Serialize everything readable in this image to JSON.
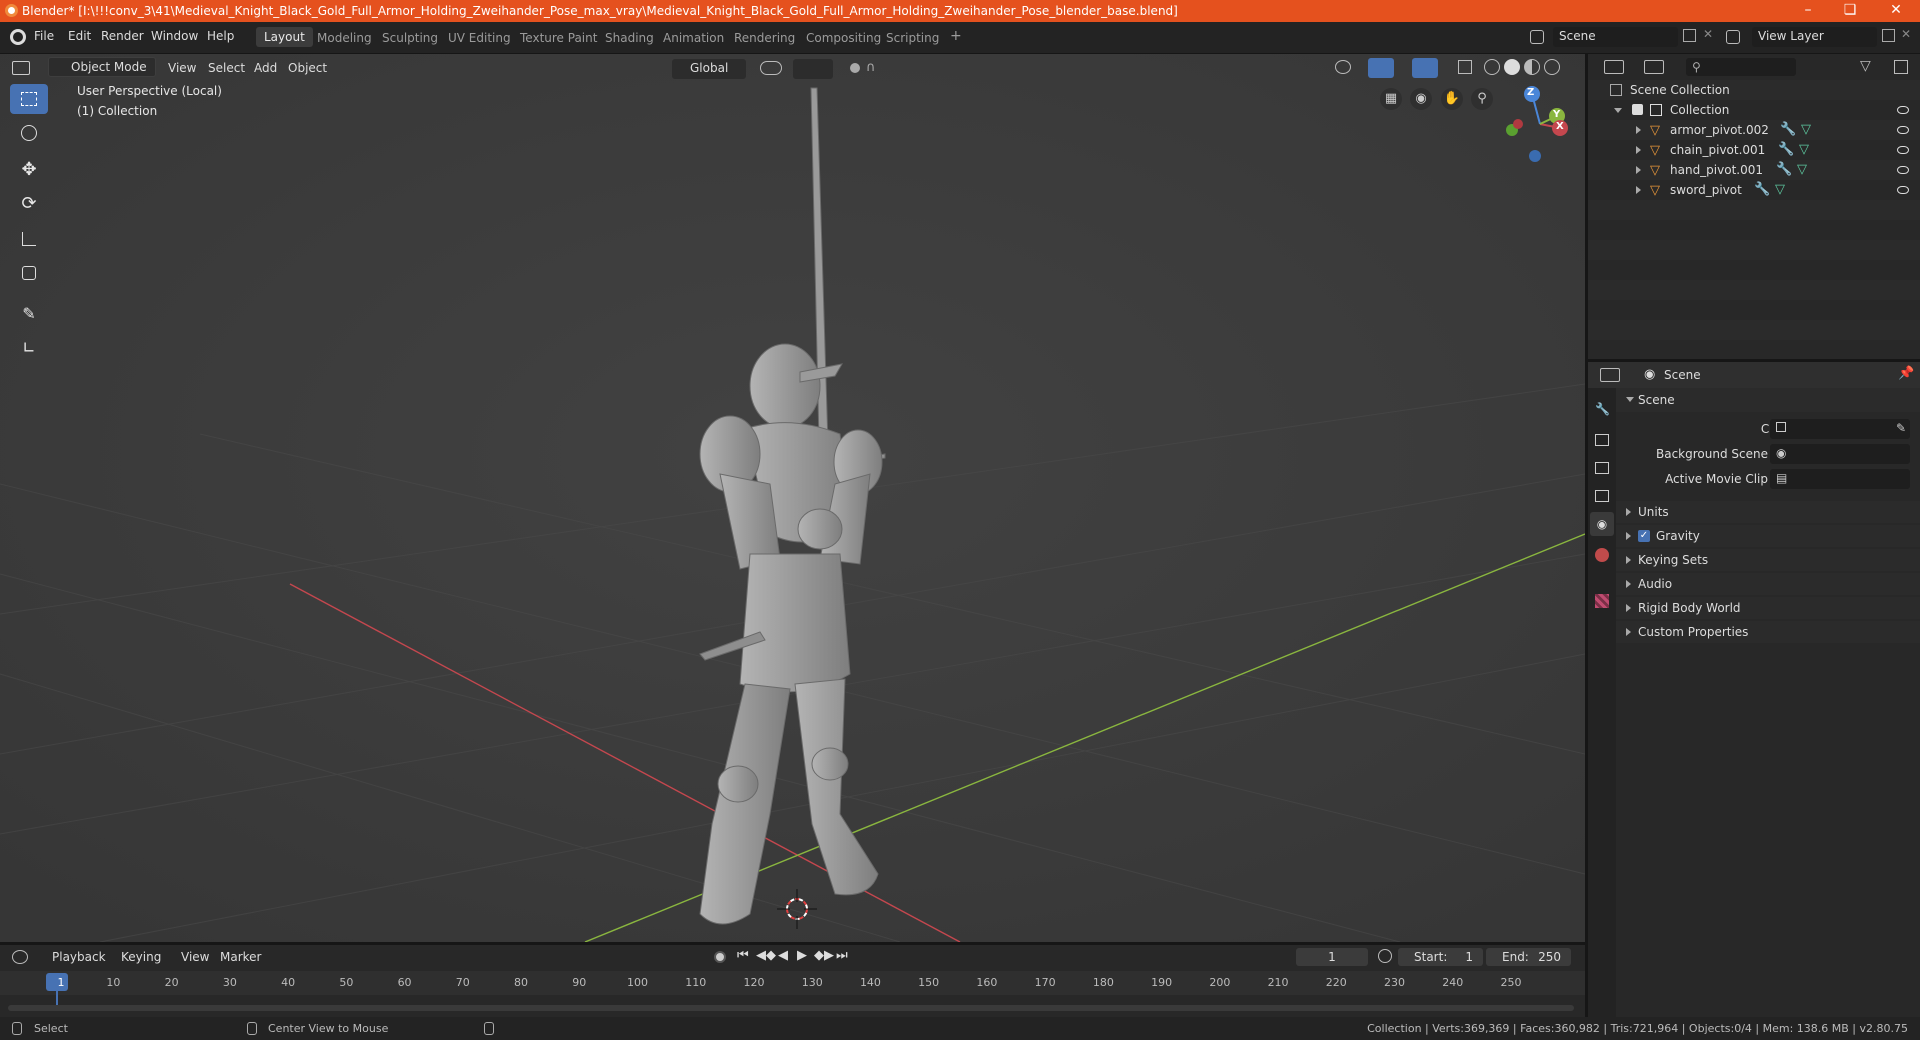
{
  "window": {
    "title": "Blender* [I:\\!!!conv_3\\41\\Medieval_Knight_Black_Gold_Full_Armor_Holding_Zweihander_Pose_max_vray\\Medieval_Knight_Black_Gold_Full_Armor_Holding_Zweihander_Pose_blender_base.blend]"
  },
  "menubar": {
    "items": [
      "File",
      "Edit",
      "Render",
      "Window",
      "Help"
    ],
    "workspaces": [
      "Layout",
      "Modeling",
      "Sculpting",
      "UV Editing",
      "Texture Paint",
      "Shading",
      "Animation",
      "Rendering",
      "Compositing",
      "Scripting"
    ],
    "add_workspace": "+",
    "scene_field": "Scene",
    "view_layer_field": "View Layer"
  },
  "viewport_header": {
    "mode": "Object Mode",
    "menus": [
      "View",
      "Select",
      "Add",
      "Object"
    ],
    "orientation": "Global"
  },
  "viewport": {
    "info_line1": "User Perspective (Local)",
    "info_line2": "(1) Collection",
    "gizmo": {
      "z": "Z",
      "y": "Y",
      "x": "X"
    }
  },
  "outliner": {
    "root": "Scene Collection",
    "collection": "Collection",
    "items": [
      "armor_pivot.002",
      "chain_pivot.001",
      "hand_pivot.001",
      "sword_pivot"
    ]
  },
  "properties": {
    "header": "Scene",
    "panel": "Scene",
    "fields": [
      {
        "label": "Camera",
        "value": ""
      },
      {
        "label": "Background Scene",
        "value": ""
      },
      {
        "label": "Active Movie Clip",
        "value": ""
      }
    ],
    "sections": [
      "Units",
      "Gravity",
      "Keying Sets",
      "Audio",
      "Rigid Body World",
      "Custom Properties"
    ],
    "gravity_checked": true
  },
  "timeline": {
    "menus": [
      "Playback",
      "Keying",
      "View",
      "Marker"
    ],
    "current_frame": "1",
    "start_label": "Start:",
    "start": "1",
    "end_label": "End:",
    "end": "250",
    "ticks": [
      "1",
      "10",
      "20",
      "30",
      "40",
      "50",
      "60",
      "70",
      "80",
      "90",
      "100",
      "110",
      "120",
      "130",
      "140",
      "150",
      "160",
      "170",
      "180",
      "190",
      "200",
      "210",
      "220",
      "230",
      "240",
      "250"
    ]
  },
  "statusbar": {
    "left": "Select",
    "middle": "Center View to Mouse",
    "right": "Collection | Verts:369,369 | Faces:360,982 | Tris:721,964 | Objects:0/4 | Mem: 138.6 MB | v2.80.75"
  },
  "colors": {
    "titlebar": "#e5511e",
    "accent": "#4772b3",
    "viewport_bg": "#3d3d3d",
    "x_axis": "#c4474e",
    "y_axis": "#8ab63f",
    "object_icon": "#e8963a"
  }
}
